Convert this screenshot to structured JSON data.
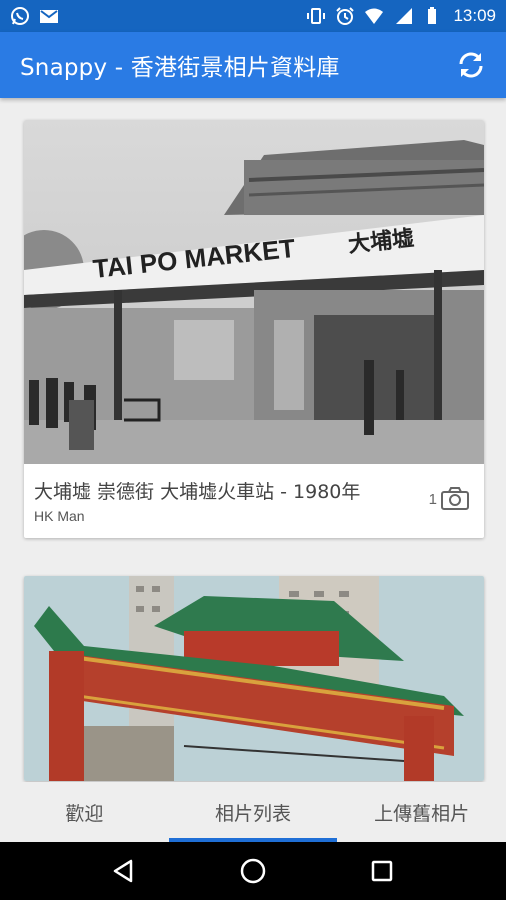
{
  "status_bar": {
    "time": "13:09",
    "icons": [
      "whatsapp-icon",
      "gmail-icon",
      "vibrate-icon",
      "alarm-icon",
      "wifi-icon",
      "signal-icon",
      "battery-icon"
    ]
  },
  "app_bar": {
    "title": "Snappy - 香港街景相片資料庫",
    "refresh_icon": "refresh-icon"
  },
  "photos": [
    {
      "title": "大埔墟 崇德街 大埔墟火車站 - 1980年",
      "author": "HK Man",
      "photo_count": "1",
      "sign_text": "TAI PO MARKET",
      "sign_chinese": "大埔墟"
    },
    {
      "title": "",
      "author": "",
      "photo_count": ""
    }
  ],
  "tabs": [
    {
      "label": "歡迎",
      "active": false
    },
    {
      "label": "相片列表",
      "active": true
    },
    {
      "label": "上傳舊相片",
      "active": false
    }
  ],
  "colors": {
    "status_bar": "#1565c0",
    "app_bar": "#2a7be4",
    "tab_indicator": "#1f6fd6"
  }
}
